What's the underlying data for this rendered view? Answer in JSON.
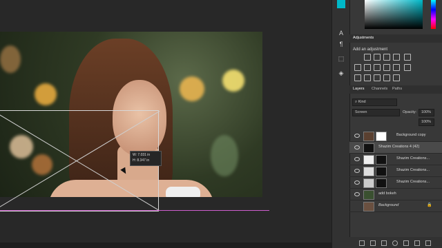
{
  "toolbar": {
    "tools": [
      "horizontal-type-icon",
      "paragraph-icon",
      "transform-icon",
      "rotate-icon",
      "layers-icon"
    ]
  },
  "adjustments": {
    "tab_label": "Adjustments",
    "title": "Add an adjustment"
  },
  "layers": {
    "tabs": [
      "Layers",
      "Channels",
      "Paths"
    ],
    "search_placeholder": "Kind",
    "blend_mode": "Screen",
    "opacity_label": "Opacity:",
    "opacity_value": "100%",
    "fill_value": "100%",
    "items": [
      {
        "name": "Background copy",
        "selected": false
      },
      {
        "name": "Shazim Creations 4 (42)",
        "selected": true
      },
      {
        "name": "Shazim Creations...",
        "selected": false
      },
      {
        "name": "Shazim Creations...",
        "selected": false
      },
      {
        "name": "Shazim Creations...",
        "selected": false
      },
      {
        "name": "add bokeh",
        "selected": false
      },
      {
        "name": "Background",
        "selected": false
      }
    ]
  },
  "measure": {
    "width_label": "W: 7.031 in",
    "height_label": "H: 8.347 in"
  },
  "colors": {
    "accent_cyan": "#00b8c8",
    "guide_magenta": "#d05fd0",
    "panel_bg": "#383838"
  }
}
